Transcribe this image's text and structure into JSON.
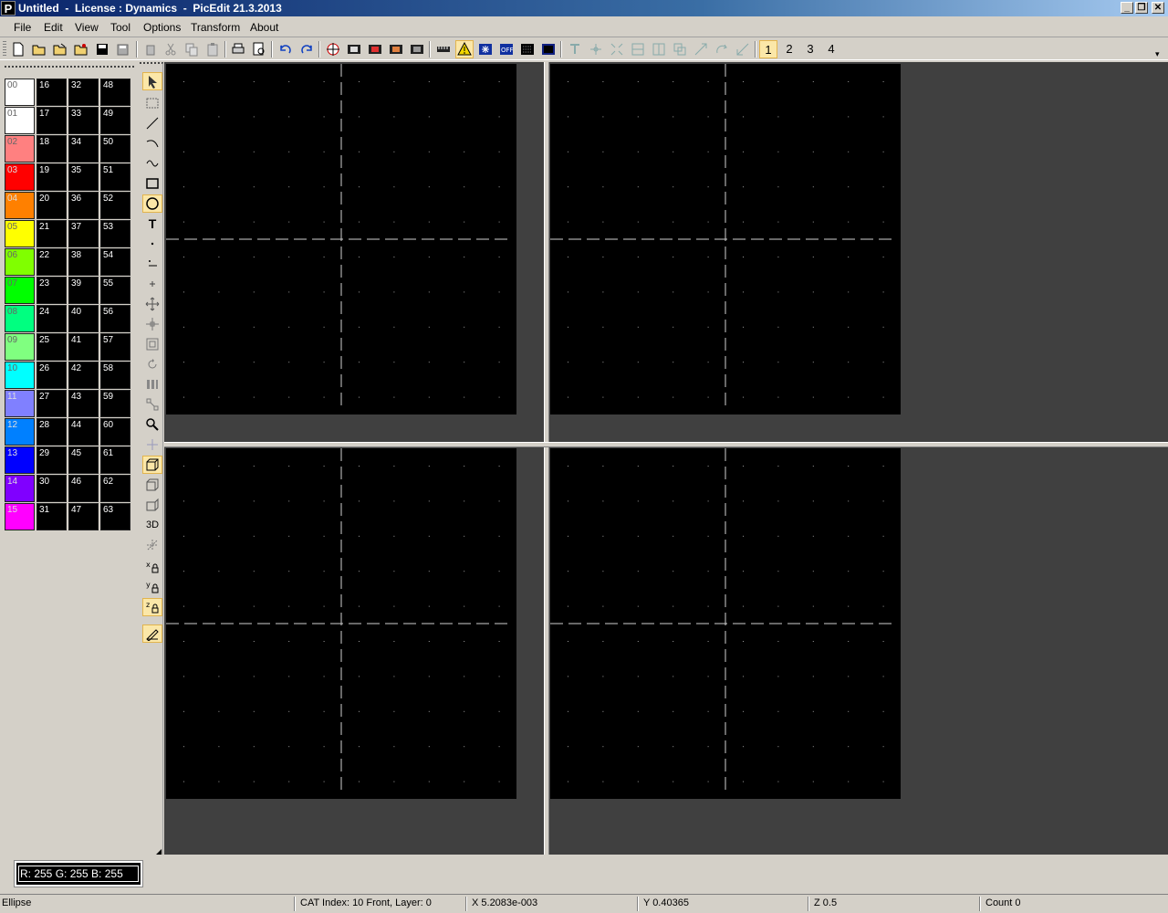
{
  "window": {
    "title": "Untitled  -  License : Dynamics  -  PicEdit 21.3.2013",
    "app_icon_letter": "P"
  },
  "menu": {
    "items": [
      {
        "label": "File"
      },
      {
        "label": "Edit"
      },
      {
        "label": "View"
      },
      {
        "label": "Tool"
      },
      {
        "label": "Options"
      },
      {
        "label": "Transform"
      },
      {
        "label": "About"
      }
    ]
  },
  "toolbar": {
    "pages": [
      "1",
      "2",
      "3",
      "4"
    ],
    "active_page": "1",
    "warning_icon_color": "#f2d600"
  },
  "palette": {
    "colors": [
      {
        "index": "00",
        "color": "#ffffff"
      },
      {
        "index": "01",
        "color": "#ffffff"
      },
      {
        "index": "02",
        "color": "#ff8080"
      },
      {
        "index": "03",
        "color": "#ff0000"
      },
      {
        "index": "04",
        "color": "#ff8000"
      },
      {
        "index": "05",
        "color": "#ffff00"
      },
      {
        "index": "06",
        "color": "#80ff00"
      },
      {
        "index": "07",
        "color": "#00ff00"
      },
      {
        "index": "08",
        "color": "#00ff80"
      },
      {
        "index": "09",
        "color": "#80ff80"
      },
      {
        "index": "10",
        "color": "#00ffff"
      },
      {
        "index": "11",
        "color": "#8080ff"
      },
      {
        "index": "12",
        "color": "#0080ff"
      },
      {
        "index": "13",
        "color": "#0000ff"
      },
      {
        "index": "14",
        "color": "#8000ff"
      },
      {
        "index": "15",
        "color": "#ff00ff"
      }
    ],
    "black_indices": [
      [
        "16",
        "17",
        "18",
        "19",
        "20",
        "21",
        "22",
        "23",
        "24",
        "25",
        "26",
        "27",
        "28",
        "29",
        "30",
        "31"
      ],
      [
        "32",
        "33",
        "34",
        "35",
        "36",
        "37",
        "38",
        "39",
        "40",
        "41",
        "42",
        "43",
        "44",
        "45",
        "46",
        "47"
      ],
      [
        "48",
        "49",
        "50",
        "51",
        "52",
        "53",
        "54",
        "55",
        "56",
        "57",
        "58",
        "59",
        "60",
        "61",
        "62",
        "63"
      ]
    ]
  },
  "tools": {
    "active": [
      "ellipse",
      "view-front",
      "lock-z",
      "snap"
    ],
    "label_3d": "3D"
  },
  "color_readout": "R: 255 G: 255 B: 255",
  "status": {
    "tool": "Ellipse",
    "cat_index": "CAT Index: 10 Front, Layer: 0",
    "x": "X 5.2083e-003",
    "y": "Y 0.40365",
    "z": "Z 0.5",
    "count": "Count 0"
  }
}
